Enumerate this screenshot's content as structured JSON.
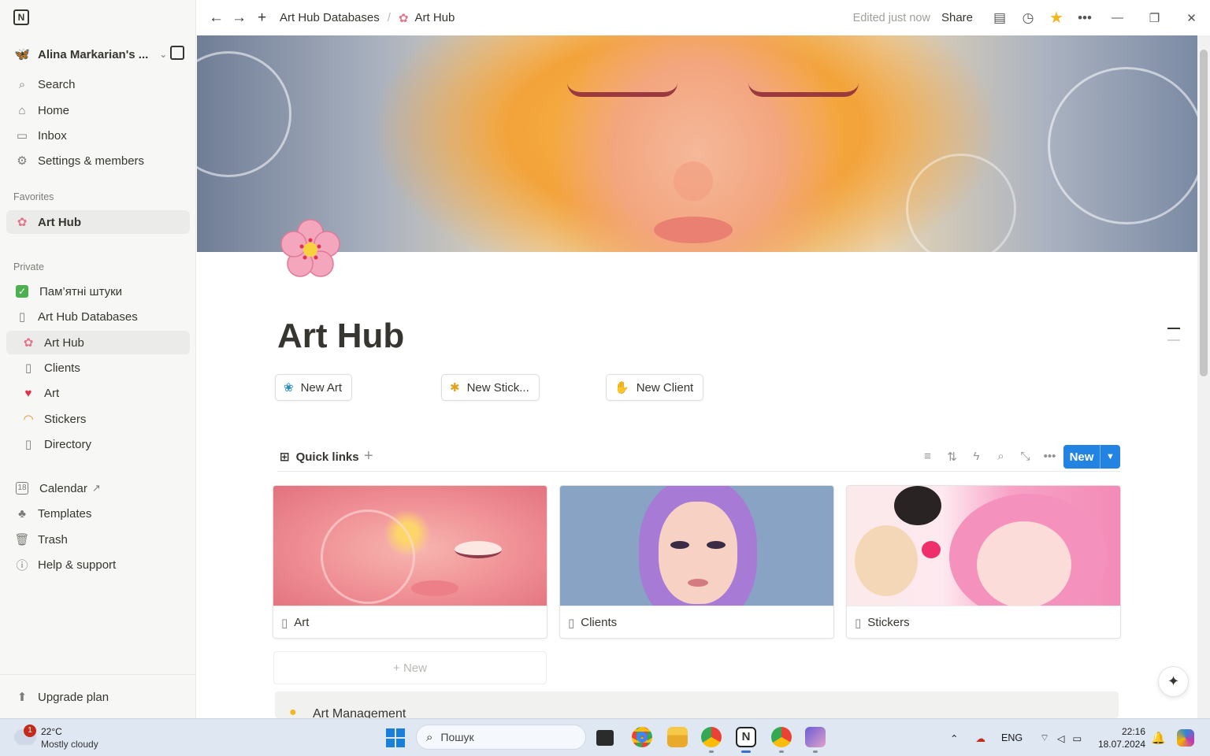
{
  "sidebar": {
    "workspace": "Alina Markarian's ...",
    "top_items": [
      {
        "label": "Search",
        "icon": "search-icon"
      },
      {
        "label": "Home",
        "icon": "home-icon"
      },
      {
        "label": "Inbox",
        "icon": "inbox-icon"
      },
      {
        "label": "Settings & members",
        "icon": "gear-icon"
      }
    ],
    "favorites_header": "Favorites",
    "favorites": [
      {
        "label": "Art Hub",
        "icon": "cherry-blossom-icon"
      }
    ],
    "private_header": "Private",
    "private": [
      {
        "label": "Пам’ятні штуки",
        "icon": "checkbox-icon"
      },
      {
        "label": "Art Hub Databases",
        "icon": "page-icon"
      },
      {
        "label": "Art Hub",
        "icon": "cherry-blossom-icon"
      },
      {
        "label": "Clients",
        "icon": "page-icon"
      },
      {
        "label": "Art",
        "icon": "heart-icon"
      },
      {
        "label": "Stickers",
        "icon": "rainbow-icon"
      },
      {
        "label": "Directory",
        "icon": "page-icon"
      }
    ],
    "bottom_items": [
      {
        "label": "Calendar",
        "icon": "calendar-icon"
      },
      {
        "label": "Templates",
        "icon": "templates-icon"
      },
      {
        "label": "Trash",
        "icon": "trash-icon"
      },
      {
        "label": "Help & support",
        "icon": "help-icon"
      }
    ],
    "upgrade": "Upgrade plan"
  },
  "topbar": {
    "breadcrumb_parent": "Art Hub Databases",
    "breadcrumb_current": "Art Hub",
    "edited": "Edited just now",
    "share": "Share"
  },
  "page": {
    "title": "Art Hub",
    "buttons": [
      {
        "label": "New Art",
        "icon": "flower-icon"
      },
      {
        "label": "New Stick...",
        "icon": "sparkle-icon"
      },
      {
        "label": "New Client",
        "icon": "hand-icon"
      }
    ],
    "quick_links": {
      "tab": "Quick links",
      "new": "New",
      "cards": [
        {
          "label": "Art"
        },
        {
          "label": "Clients"
        },
        {
          "label": "Stickers"
        }
      ],
      "add_new": "+ New"
    },
    "callout": "Art Management"
  },
  "taskbar": {
    "weather_temp": "22°C",
    "weather_desc": "Mostly cloudy",
    "weather_badge": "1",
    "search_placeholder": "Пошук",
    "lang": "ENG",
    "time": "22:16",
    "date": "18.07.2024"
  },
  "colors": {
    "accent": "#2383e2",
    "sidebar_bg": "#f7f7f5",
    "star": "#f2b620"
  }
}
